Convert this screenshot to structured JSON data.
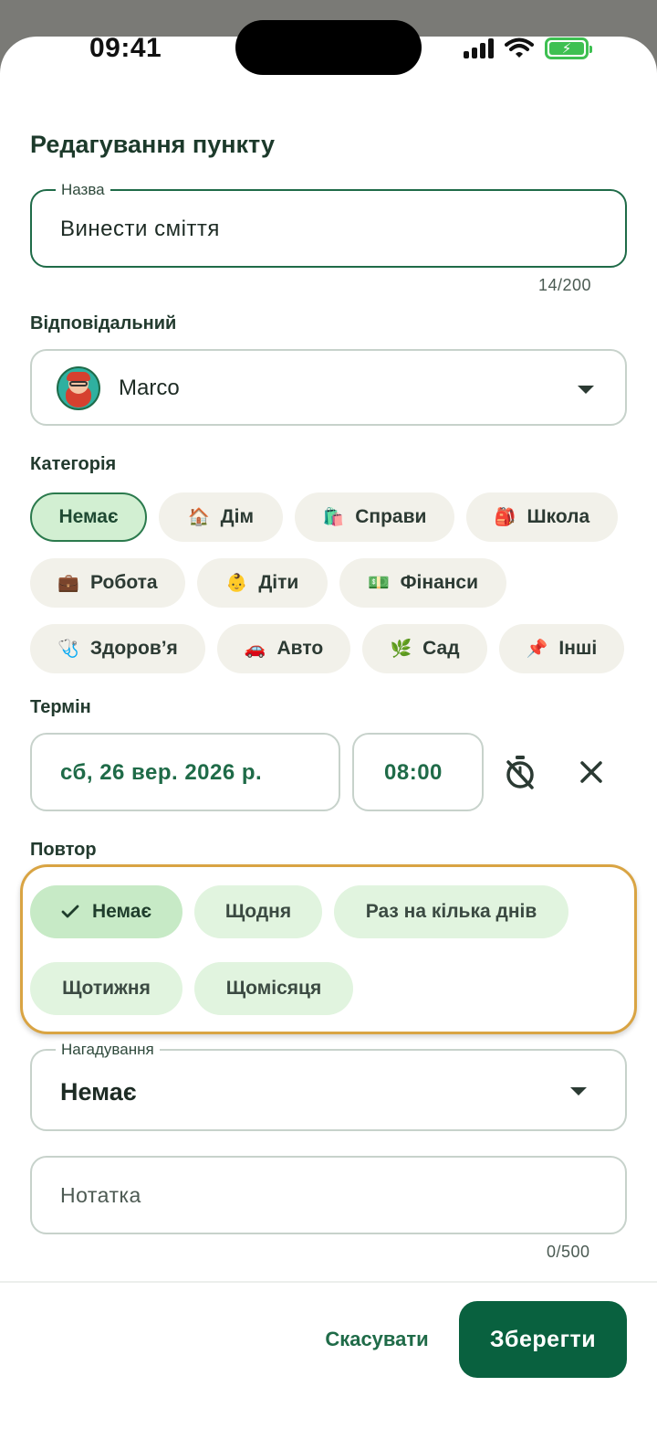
{
  "status_bar": {
    "time": "09:41"
  },
  "screen": {
    "title": "Редагування пункту"
  },
  "name_field": {
    "label": "Назва",
    "value": "Винести сміття",
    "counter": "14/200"
  },
  "assignee": {
    "label": "Відповідальний",
    "value": "Marco"
  },
  "category": {
    "label": "Категорія",
    "items": [
      {
        "emoji": "",
        "label": "Немає"
      },
      {
        "emoji": "🏠",
        "label": "Дім"
      },
      {
        "emoji": "🛍️",
        "label": "Справи"
      },
      {
        "emoji": "🎒",
        "label": "Школа"
      },
      {
        "emoji": "💼",
        "label": "Робота"
      },
      {
        "emoji": "👶",
        "label": "Діти"
      },
      {
        "emoji": "💵",
        "label": "Фінанси"
      },
      {
        "emoji": "🩺",
        "label": "Здоров’я"
      },
      {
        "emoji": "🚗",
        "label": "Авто"
      },
      {
        "emoji": "🌿",
        "label": "Сад"
      },
      {
        "emoji": "📌",
        "label": "Інші"
      }
    ],
    "selected": "Немає"
  },
  "due": {
    "label": "Термін",
    "date": "сб, 26 вер. 2026 р.",
    "time": "08:00"
  },
  "repeat": {
    "label": "Повтор",
    "options": [
      "Немає",
      "Щодня",
      "Раз на кілька днів",
      "Щотижня",
      "Щомісяця"
    ],
    "selected": "Немає"
  },
  "reminder": {
    "label": "Нагадування",
    "value": "Немає"
  },
  "note": {
    "placeholder": "Нотатка",
    "counter": "0/500"
  },
  "actions": {
    "cancel": "Скасувати",
    "save": "Зберегти"
  },
  "colors": {
    "accent": "#09613f",
    "highlight_border": "#d9a443",
    "chip_selected": "#d2efd2"
  }
}
